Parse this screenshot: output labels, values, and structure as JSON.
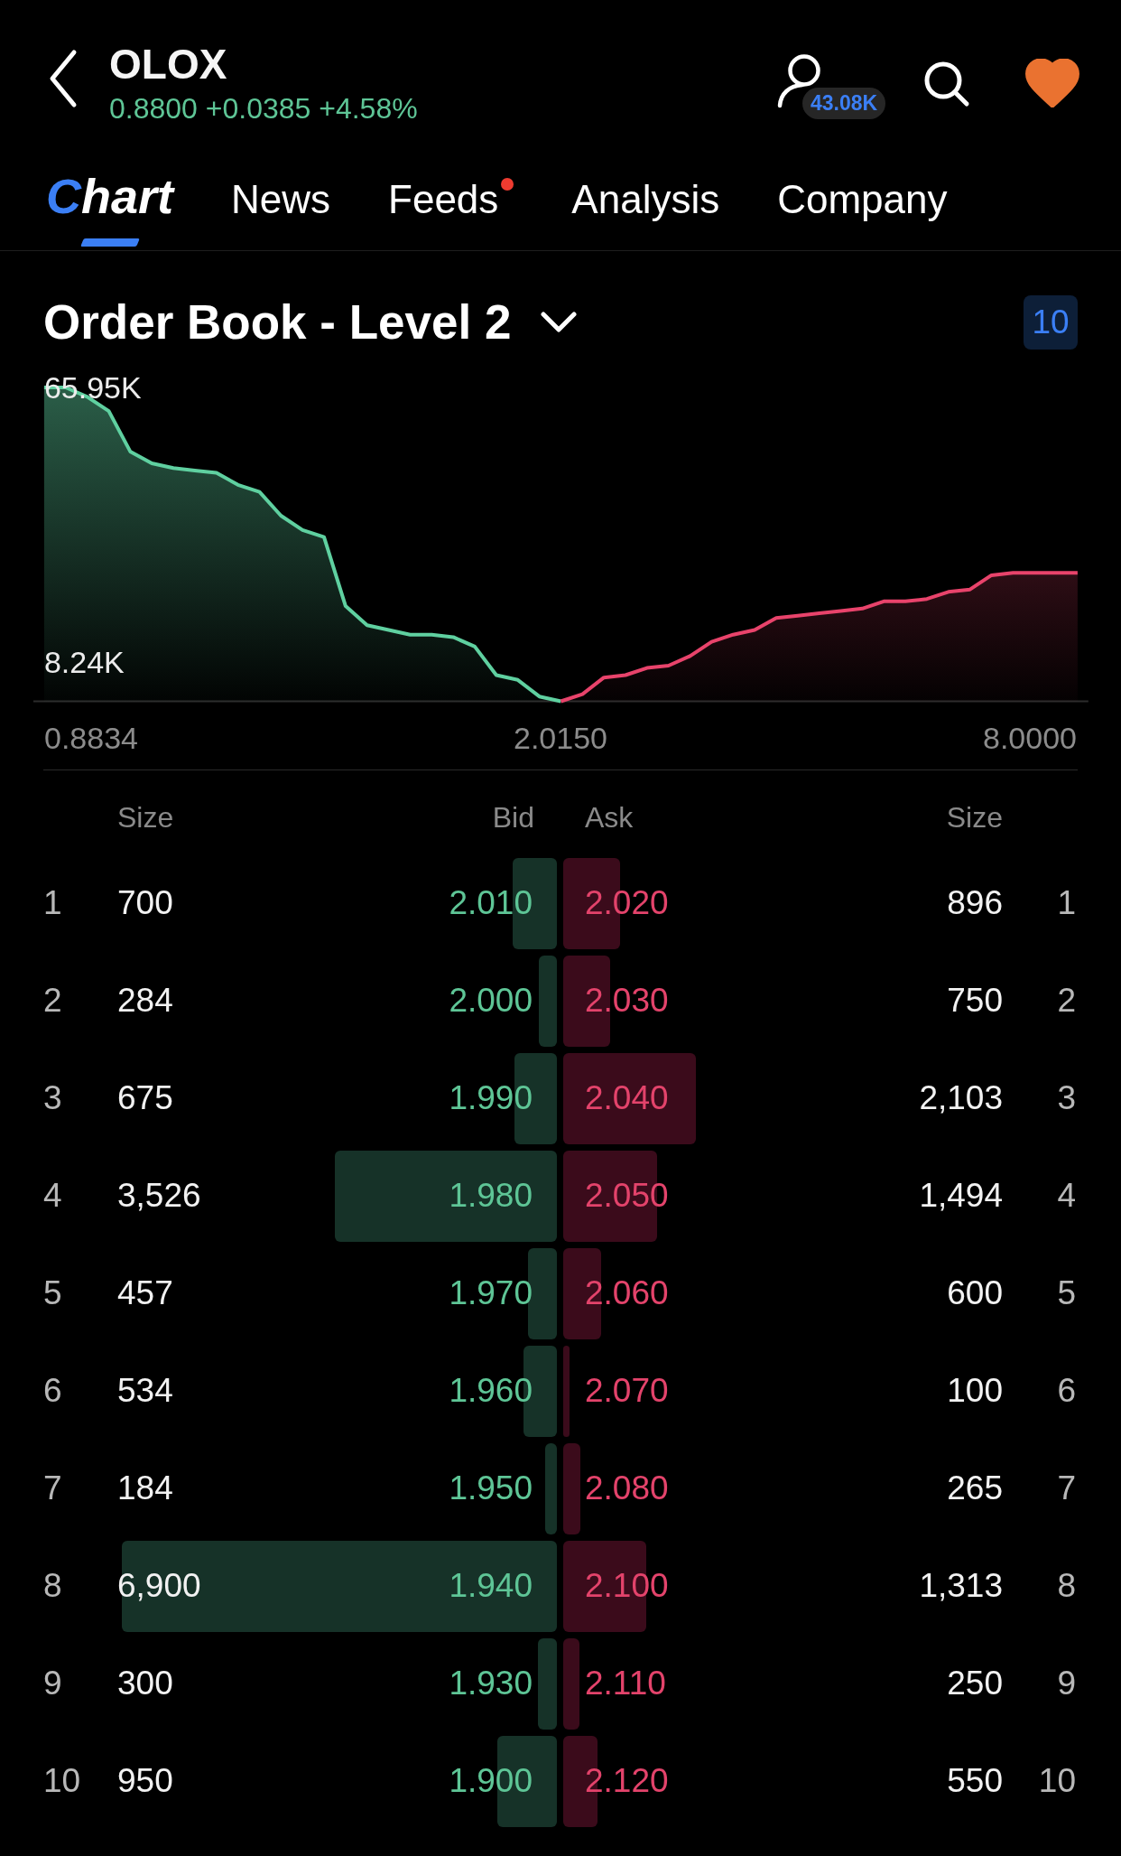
{
  "header": {
    "title": "OLOX",
    "quote": "0.8800 +0.0385 +4.58%",
    "badge": "43.08K",
    "favorited": true
  },
  "tabs": [
    {
      "label": "Chart",
      "selected": true,
      "unread": false
    },
    {
      "label": "News",
      "selected": false,
      "unread": false
    },
    {
      "label": "Feeds",
      "selected": false,
      "unread": true
    },
    {
      "label": "Analysis",
      "selected": false,
      "unread": false
    },
    {
      "label": "Company",
      "selected": false,
      "unread": false
    }
  ],
  "order_book": {
    "title": "Order Book - Level 2",
    "depth": "10",
    "depth_chart": {
      "chart_data": {
        "type": "area",
        "series": [
          {
            "color": "#5fd0a0",
            "values": [
              65950,
              65950,
              64000,
              61000,
              52500,
              50000,
              49000,
              48500,
              48000,
              45500,
              44000,
              39000,
              36000,
              34500,
              20000,
              16000,
              15000,
              14000,
              14000,
              13500,
              11500,
              5500,
              4500,
              1000,
              0,
              null,
              null,
              null,
              null,
              null,
              null,
              null,
              null,
              null,
              null,
              null,
              null,
              null,
              null,
              null,
              null,
              null,
              null,
              null,
              null,
              null,
              null,
              null,
              null
            ]
          },
          {
            "color": "#e8436b",
            "values": [
              null,
              null,
              null,
              null,
              null,
              null,
              null,
              null,
              null,
              null,
              null,
              null,
              null,
              null,
              null,
              null,
              null,
              null,
              null,
              null,
              null,
              null,
              null,
              null,
              0,
              1500,
              5000,
              5500,
              7000,
              7500,
              9500,
              12500,
              14000,
              15000,
              17500,
              18000,
              18500,
              19000,
              19500,
              21000,
              21000,
              21500,
              23000,
              23500,
              26500,
              27000,
              27000,
              27000,
              27000
            ]
          }
        ],
        "ylim": [
          0,
          65950
        ],
        "yticks": [
          {
            "value": 65950,
            "label": "65.95K"
          },
          {
            "value": 8240,
            "label": "8.24K"
          }
        ]
      },
      "x_labels": [
        "0.8834",
        "2.0150",
        "8.0000"
      ]
    },
    "columns": [
      "Size",
      "Bid",
      "Ask",
      "Size"
    ],
    "rows": [
      {
        "bid": {
          "no": "1",
          "size": "700",
          "price": "2.010"
        },
        "ask": {
          "price": "2.020",
          "size": "896",
          "no": "1"
        }
      },
      {
        "bid": {
          "no": "2",
          "size": "284",
          "price": "2.000"
        },
        "ask": {
          "price": "2.030",
          "size": "750",
          "no": "2"
        }
      },
      {
        "bid": {
          "no": "3",
          "size": "675",
          "price": "1.990"
        },
        "ask": {
          "price": "2.040",
          "size": "2,103",
          "no": "3"
        }
      },
      {
        "bid": {
          "no": "4",
          "size": "3,526",
          "price": "1.980"
        },
        "ask": {
          "price": "2.050",
          "size": "1,494",
          "no": "4"
        }
      },
      {
        "bid": {
          "no": "5",
          "size": "457",
          "price": "1.970"
        },
        "ask": {
          "price": "2.060",
          "size": "600",
          "no": "5"
        }
      },
      {
        "bid": {
          "no": "6",
          "size": "534",
          "price": "1.960"
        },
        "ask": {
          "price": "2.070",
          "size": "100",
          "no": "6"
        }
      },
      {
        "bid": {
          "no": "7",
          "size": "184",
          "price": "1.950"
        },
        "ask": {
          "price": "2.080",
          "size": "265",
          "no": "7"
        }
      },
      {
        "bid": {
          "no": "8",
          "size": "6,900",
          "price": "1.940"
        },
        "ask": {
          "price": "2.100",
          "size": "1,313",
          "no": "8"
        }
      },
      {
        "bid": {
          "no": "9",
          "size": "300",
          "price": "1.930"
        },
        "ask": {
          "price": "2.110",
          "size": "250",
          "no": "9"
        }
      },
      {
        "bid": {
          "no": "10",
          "size": "950",
          "price": "1.900"
        },
        "ask": {
          "price": "2.120",
          "size": "550",
          "no": "10"
        }
      }
    ]
  }
}
